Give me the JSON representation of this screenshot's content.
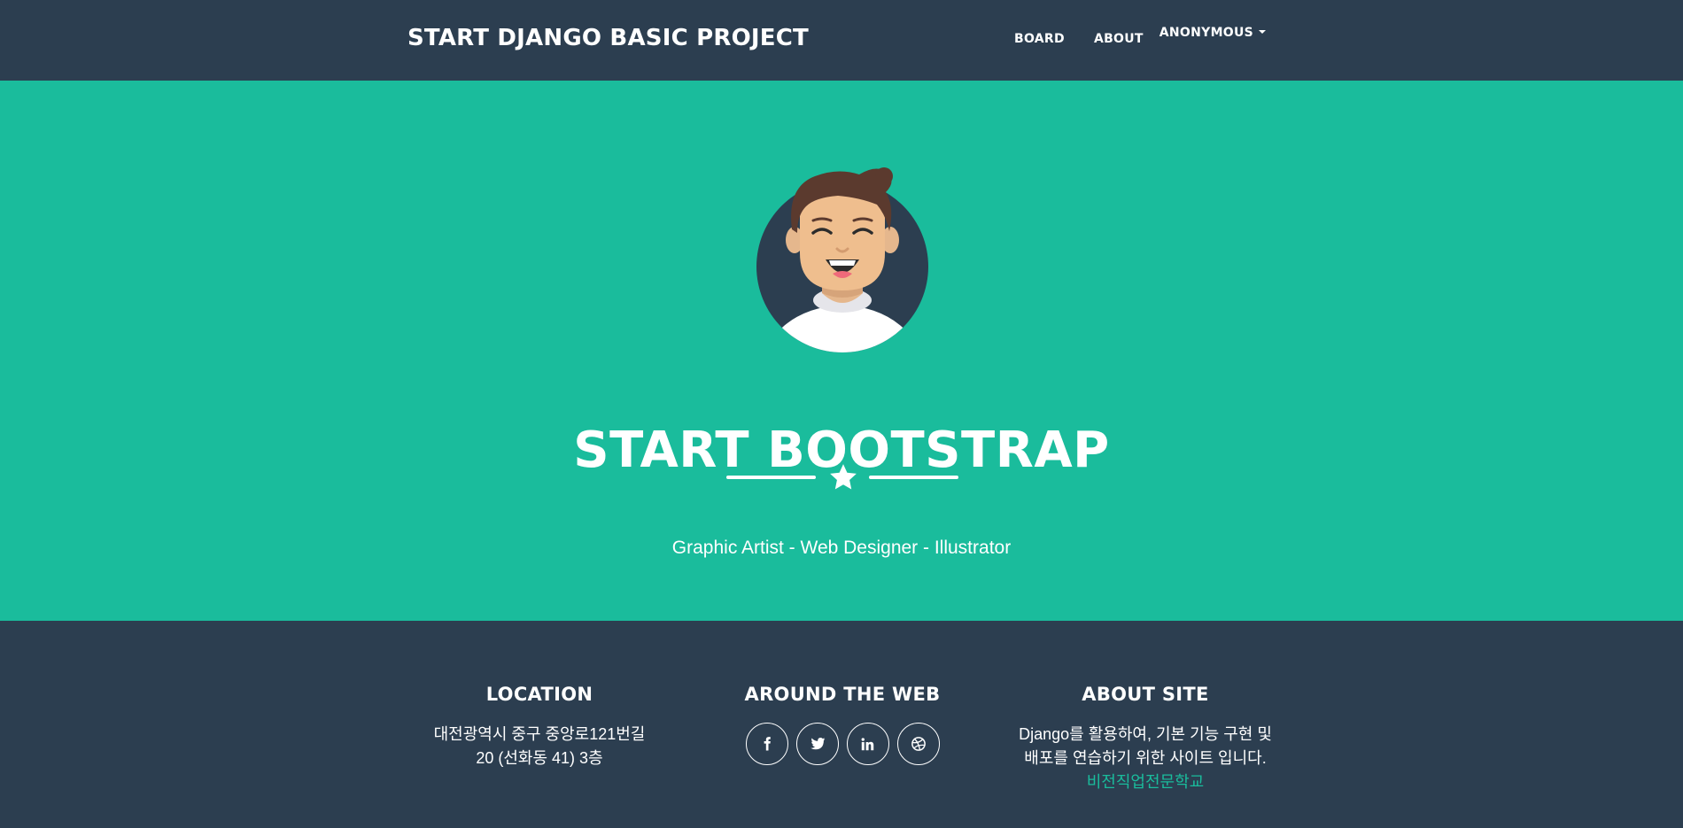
{
  "navbar": {
    "brand": "START DJANGO BASIC PROJECT",
    "links": [
      {
        "label": "BOARD"
      },
      {
        "label": "ABOUT"
      }
    ],
    "user_menu": {
      "label": "ANONYMOUS",
      "icon": "caret-down-icon"
    }
  },
  "masthead": {
    "avatar_icon": "avatar-icon",
    "heading": "START BOOTSTRAP",
    "divider_icon": "star-icon",
    "subheading": "Graphic Artist - Web Designer - Illustrator"
  },
  "footer": {
    "location": {
      "heading": "LOCATION",
      "line1": "대전광역시 중구 중앙로121번길",
      "line2": "20 (선화동 41) 3층"
    },
    "web": {
      "heading": "AROUND THE WEB",
      "socials": [
        {
          "icon": "facebook-icon"
        },
        {
          "icon": "twitter-icon"
        },
        {
          "icon": "linkedin-icon"
        },
        {
          "icon": "dribbble-icon"
        }
      ]
    },
    "about": {
      "heading": "ABOUT SITE",
      "line1": "Django를 활용하여, 기본 기능 구현 및",
      "line2": "배포를 연습하기 위한 사이트 입니다.",
      "link": "비전직업전문학교"
    }
  },
  "colors": {
    "primary": "#2c3e50",
    "accent": "#1abc9c",
    "text": "#ffffff"
  }
}
